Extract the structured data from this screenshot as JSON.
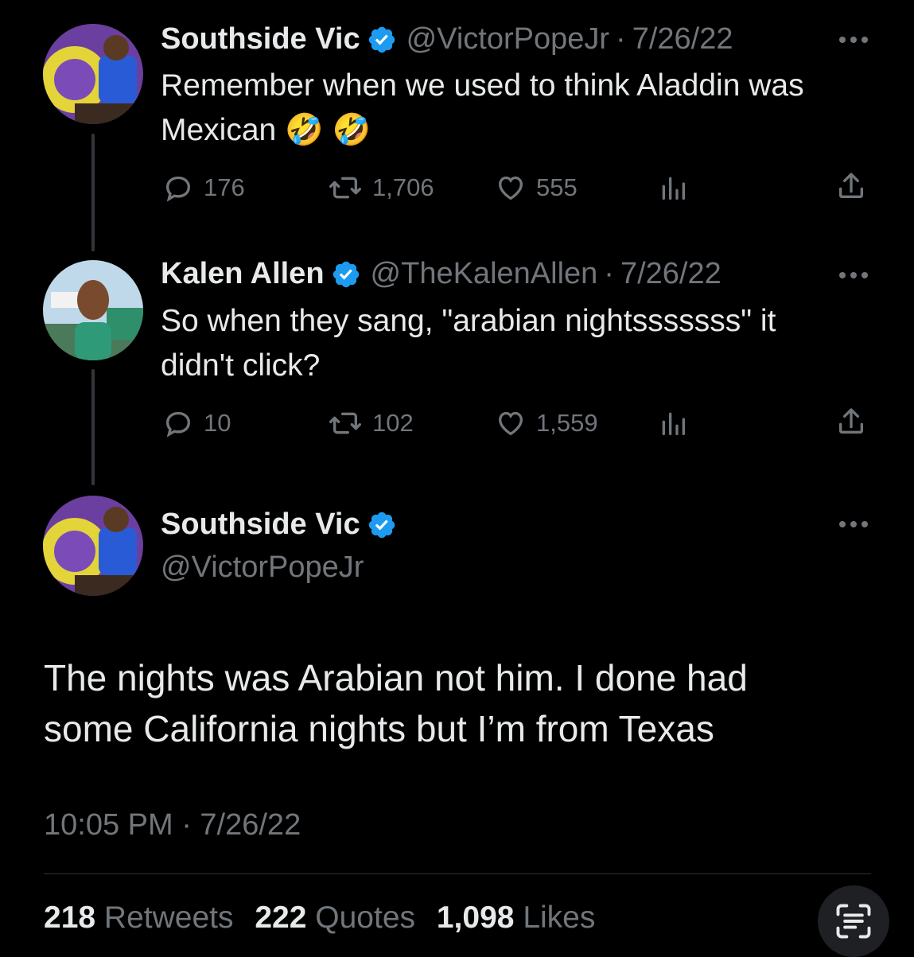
{
  "tweets": [
    {
      "name": "Southside Vic",
      "handle": "@VictorPopeJr",
      "date": "7/26/22",
      "text_line1": "Remember when we used to think Aladdin was",
      "text_line2": "Mexican 🤣 🤣",
      "replies": "176",
      "retweets": "1,706",
      "likes": "555"
    },
    {
      "name": "Kalen Allen",
      "handle": "@TheKalenAllen",
      "date": "7/26/22",
      "text_line1": "So when they sang, \"arabian nightsssssss\" it",
      "text_line2": "didn't click?",
      "replies": "10",
      "retweets": "102",
      "likes": "1,559"
    }
  ],
  "main_tweet": {
    "name": "Southside Vic",
    "handle": "@VictorPopeJr",
    "text_line1": "The nights was Arabian not him. I done had",
    "text_line2": "some California nights but I’m from Texas",
    "timestamp": "10:05 PM · 7/26/22",
    "stats": {
      "retweets_count": "218",
      "retweets_label": "Retweets",
      "quotes_count": "222",
      "quotes_label": "Quotes",
      "likes_count": "1,098",
      "likes_label": "Likes"
    }
  },
  "separator": "·",
  "colors": {
    "background": "#000000",
    "text": "#e7e9ea",
    "muted": "#71767b",
    "verified": "#1d9bf0"
  },
  "icons": [
    "reply-icon",
    "retweet-icon",
    "like-icon",
    "views-icon",
    "share-icon",
    "more-icon",
    "verified-badge-icon",
    "scan-text-icon"
  ]
}
